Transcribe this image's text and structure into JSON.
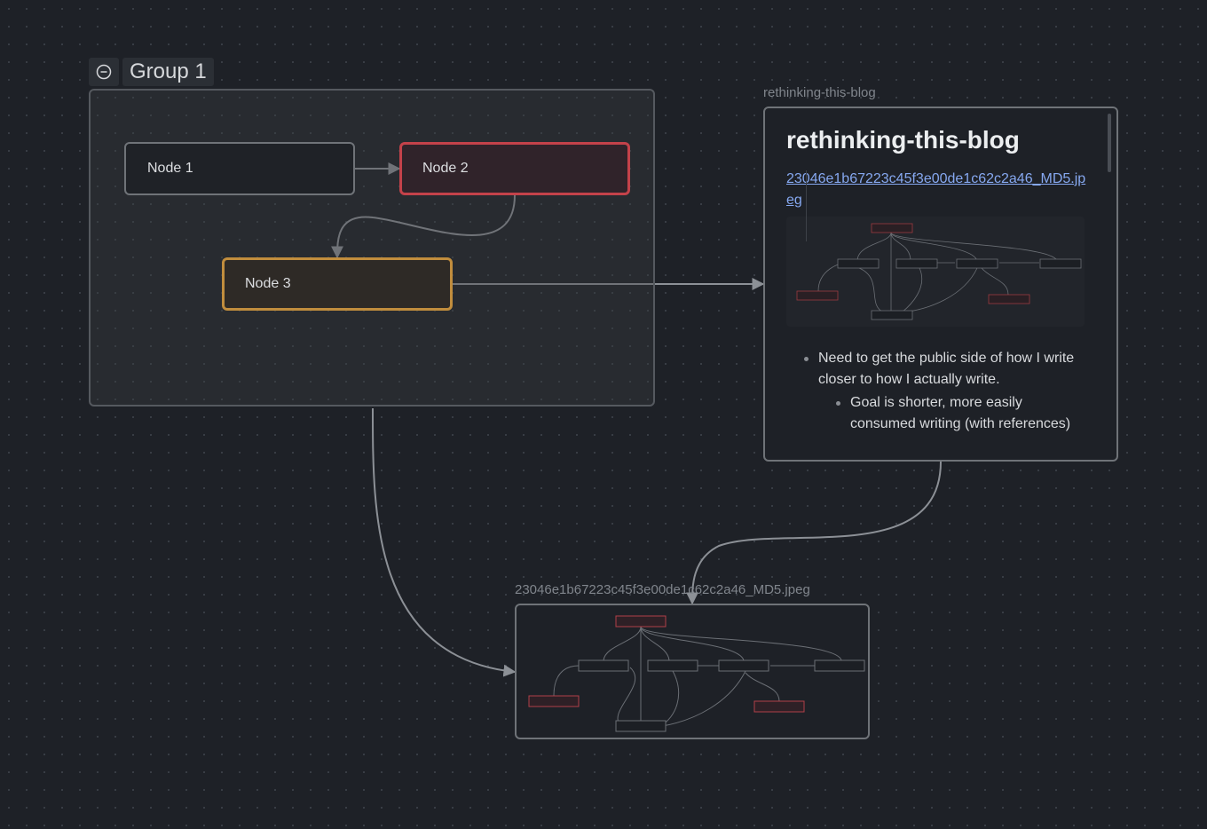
{
  "group": {
    "title": "Group 1",
    "collapse_icon": "minus-circle-icon"
  },
  "nodes": [
    {
      "label": "Node 1",
      "color": "#6f7378"
    },
    {
      "label": "Node 2",
      "color": "#c4424a"
    },
    {
      "label": "Node 3",
      "color": "#c18d3d"
    }
  ],
  "blog_file": {
    "label": "rethinking-this-blog",
    "heading": "rethinking-this-blog",
    "link_text": "23046e1b67223c45f3e00de1c62c2a46_MD5.jpeg",
    "bullets": [
      "Need to get the public side of how I write closer to how I actually write."
    ],
    "sub_bullets": [
      "Goal is shorter, more easily consumed writing (with references)"
    ]
  },
  "image_file": {
    "label": "23046e1b67223c45f3e00de1c62c2a46_MD5.jpeg"
  },
  "colors": {
    "background": "#1e2127",
    "edge": "#8c9096",
    "link": "#86a8f0",
    "red_node": "#c4424a",
    "orange_node": "#c18d3d"
  }
}
